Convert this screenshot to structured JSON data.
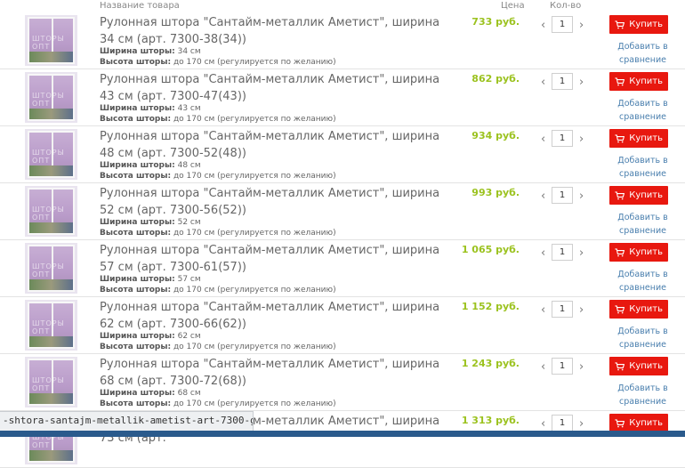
{
  "header": {
    "name_label": "Название товара",
    "price_label": "Цена",
    "qty_label": "Кол-во"
  },
  "icons": {
    "cart": "cart-icon",
    "left": "chevron-left-icon",
    "right": "chevron-right-icon"
  },
  "colors": {
    "buy_button": "#e8180f",
    "price": "#9bc21e",
    "link": "#4a7fae"
  },
  "thumb_watermark": "ШТОРЫ ОПТ",
  "spec_labels": {
    "width": "Ширина шторы:",
    "height": "Высота шторы:"
  },
  "height_value": " до 170 см (регулируется по желанию)",
  "buy_label": "Купить",
  "compare_label": "Добавить в сравнение",
  "arrows": {
    "left": "‹",
    "right": "›"
  },
  "products": [
    {
      "title": "Рулонная штора \"Сантайм-металлик Аметист\", ширина 34 см (арт. 7300-38(34))",
      "width": " 34 см",
      "price": "733 руб.",
      "qty": "1"
    },
    {
      "title": "Рулонная штора \"Сантайм-металлик Аметист\", ширина 43 см (арт. 7300-47(43))",
      "width": " 43 см",
      "price": "862 руб.",
      "qty": "1"
    },
    {
      "title": "Рулонная штора \"Сантайм-металлик Аметист\", ширина 48 см (арт. 7300-52(48))",
      "width": " 48 см",
      "price": "934 руб.",
      "qty": "1"
    },
    {
      "title": "Рулонная штора \"Сантайм-металлик Аметист\", ширина 52 см (арт. 7300-56(52))",
      "width": " 52 см",
      "price": "993 руб.",
      "qty": "1"
    },
    {
      "title": "Рулонная штора \"Сантайм-металлик Аметист\", ширина 57 см (арт. 7300-61(57))",
      "width": " 57 см",
      "price": "1 065 руб.",
      "qty": "1"
    },
    {
      "title": "Рулонная штора \"Сантайм-металлик Аметист\", ширина 62 см (арт. 7300-66(62))",
      "width": " 62 см",
      "price": "1 152 руб.",
      "qty": "1"
    },
    {
      "title": "Рулонная штора \"Сантайм-металлик Аметист\", ширина 68 см (арт. 7300-72(68))",
      "width": " 68 см",
      "price": "1 243 руб.",
      "qty": "1"
    },
    {
      "title": "Рулонная штора \"Сантайм-металлик Аметист\", ширина 73 см (арт.",
      "width": "",
      "price": "1 313 руб.",
      "qty": "1"
    }
  ],
  "status_url": "-shtora-santajm-metallik-ametist-art-7300-gr"
}
